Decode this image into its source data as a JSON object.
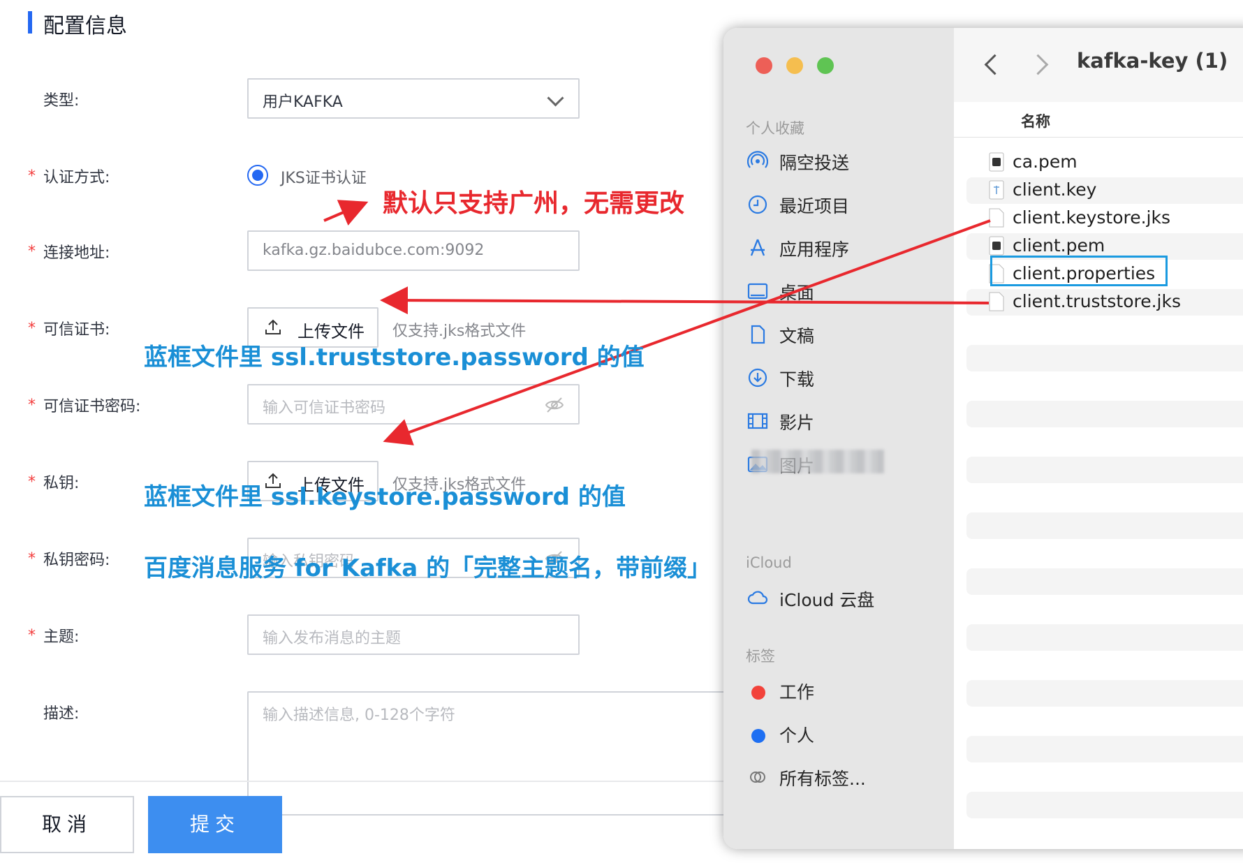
{
  "form": {
    "section_title": "配置信息",
    "type": {
      "label": "类型:",
      "value": "用户KAFKA"
    },
    "auth": {
      "star": "*",
      "label": "认证方式:",
      "option": "JKS证书认证"
    },
    "address": {
      "star": "*",
      "label": "连接地址:",
      "placeholder": "kafka.gz.baidubce.com:9092"
    },
    "trust_cert": {
      "star": "*",
      "label": "可信证书:",
      "button": "上传文件",
      "hint": "仅支持.jks格式文件"
    },
    "trust_pwd": {
      "star": "*",
      "label": "可信证书密码:",
      "placeholder": "输入可信证书密码"
    },
    "private_key": {
      "star": "*",
      "label": "私钥:",
      "button": "上传文件",
      "hint": "仅支持.jks格式文件"
    },
    "key_pwd": {
      "star": "*",
      "label": "私钥密码:",
      "placeholder": "输入私钥密码"
    },
    "topic": {
      "star": "*",
      "label": "主题:",
      "placeholder": "输入发布消息的主题"
    },
    "desc": {
      "label": "描述:",
      "placeholder": "输入描述信息, 0-128个字符"
    },
    "cancel": "取消",
    "submit": "提交"
  },
  "annotations": {
    "region_note": "默认只支持广州，无需更改",
    "trust_pwd_note": "蓝框文件里 ssl.truststore.password 的值",
    "key_pwd_note": "蓝框文件里 ssl.keystore.password 的值",
    "topic_note": "百度消息服务 for Kafka 的「完整主题名，带前缀」",
    "red": "#e8282e",
    "blue": "#1a8fd6"
  },
  "finder": {
    "title": "kafka-key (1)",
    "column": "名称",
    "favorites_head": "个人收藏",
    "favorites": [
      {
        "label": "隔空投送",
        "icon": "airdrop-icon"
      },
      {
        "label": "最近项目",
        "icon": "clock-icon"
      },
      {
        "label": "应用程序",
        "icon": "applications-icon"
      },
      {
        "label": "桌面",
        "icon": "desktop-icon"
      },
      {
        "label": "文稿",
        "icon": "document-icon"
      },
      {
        "label": "下载",
        "icon": "download-icon"
      },
      {
        "label": "影片",
        "icon": "film-icon"
      },
      {
        "label": "图片",
        "icon": "photo-icon"
      }
    ],
    "icloud_head": "iCloud",
    "icloud_item": "iCloud 云盘",
    "tags_head": "标签",
    "tags": [
      {
        "label": "工作",
        "color": "#f2423a"
      },
      {
        "label": "个人",
        "color": "#1e6ff2"
      },
      {
        "label": "所有标签...",
        "color": ""
      }
    ],
    "files": [
      "ca.pem",
      "client.key",
      "client.keystore.jks",
      "client.pem",
      "client.properties",
      "client.truststore.jks"
    ]
  }
}
